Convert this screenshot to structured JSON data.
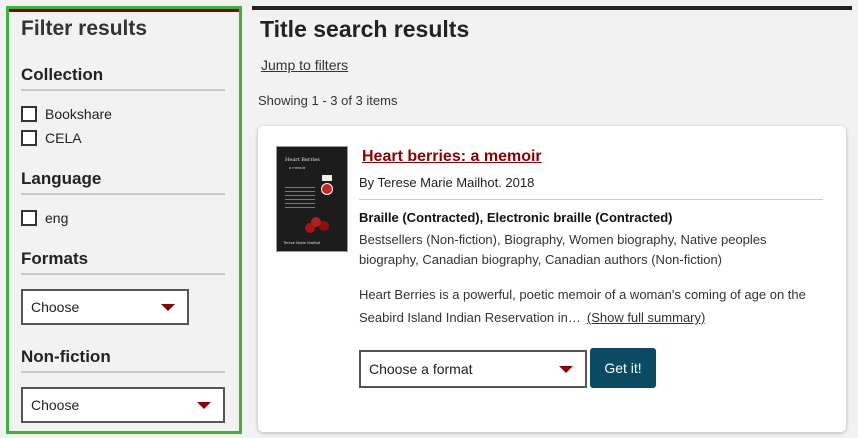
{
  "sidebar": {
    "title": "Filter results",
    "collection": {
      "heading": "Collection",
      "options": [
        "Bookshare",
        "CELA"
      ]
    },
    "language": {
      "heading": "Language",
      "options": [
        "eng"
      ]
    },
    "formats": {
      "heading": "Formats",
      "selected": "Choose"
    },
    "nonfiction": {
      "heading": "Non-fiction",
      "selected": "Choose"
    }
  },
  "main": {
    "title": "Title search results",
    "jump_link": "Jump to filters",
    "showing": "Showing 1 - 3 of 3 items"
  },
  "result": {
    "title": "Heart berries: a memoir",
    "byline": "By Terese Marie Mailhot. 2018",
    "formats": "Braille (Contracted), Electronic braille (Contracted)",
    "subjects": "Bestsellers (Non-fiction), Biography, Women biography, Native peoples biography, Canadian biography, Canadian authors (Non-fiction)",
    "summary": "Heart Berries is a powerful, poetic memoir of a woman's coming of age on the Seabird Island Indian Reservation in…",
    "show_summary": "(Show full summary)",
    "format_select": "Choose a format",
    "get_button": "Get it!",
    "cover": {
      "title": "Heart Berries",
      "subtitle": "a memoir",
      "author": "Terese Marie Mailhot"
    }
  },
  "colors": {
    "filter_border": "#3ab53a",
    "link_title": "#8b0000",
    "button": "#0b4a63"
  }
}
